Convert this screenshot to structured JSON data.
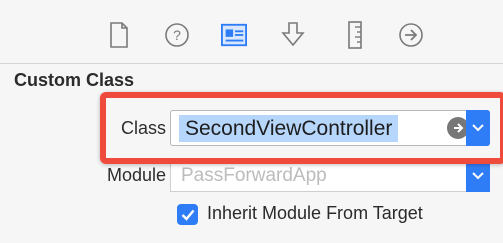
{
  "toolbar": {
    "icons": [
      "file-icon",
      "help-icon",
      "identity-icon",
      "attributes-icon",
      "size-icon",
      "connections-icon"
    ]
  },
  "section": {
    "title": "Custom Class"
  },
  "class_field": {
    "label": "Class",
    "value": "SecondViewController"
  },
  "module_field": {
    "label": "Module",
    "placeholder": "PassForwardApp"
  },
  "inherit_checkbox": {
    "label": "Inherit Module From Target",
    "checked": true
  },
  "colors": {
    "accent": "#2f7df6",
    "highlight": "#ee4b3c",
    "selection": "#b6d6fb"
  }
}
